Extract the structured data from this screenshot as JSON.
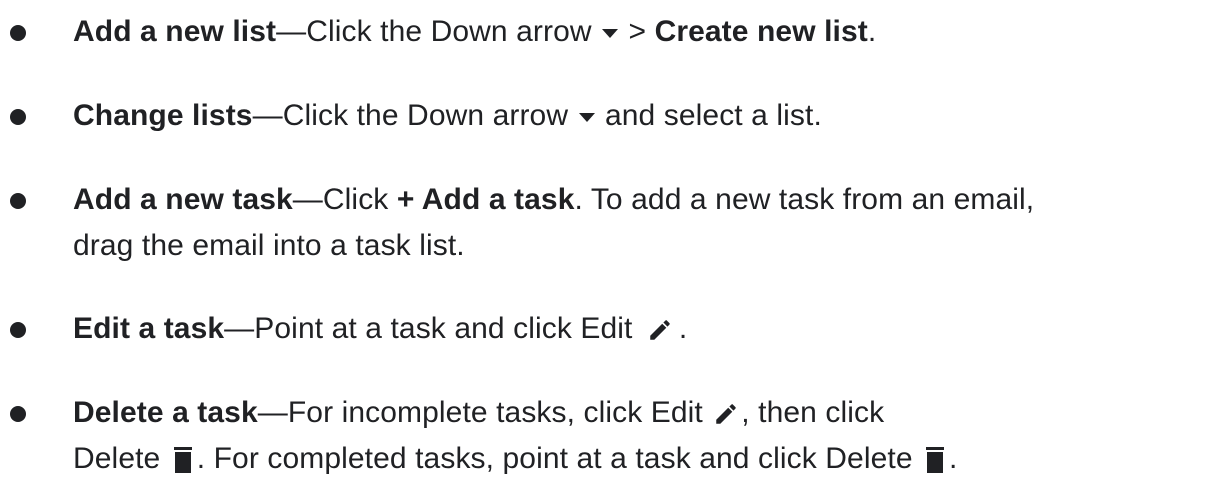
{
  "icons": {
    "down_arrow": "down-arrow-icon",
    "edit": "pencil-icon",
    "delete": "trash-icon"
  },
  "items": [
    {
      "title": "Add a new list",
      "dash": "—",
      "t1": "Click the Down arrow",
      "t2": " > ",
      "b1": "Create new list",
      "t3": "."
    },
    {
      "title": "Change lists",
      "dash": "—",
      "t1": "Click the Down arrow",
      "t2": " and select a list."
    },
    {
      "title": "Add a new task",
      "dash": "—",
      "t1": "Click ",
      "b1": "+ Add a task",
      "t2": ". To add a new task from an email,",
      "t3": "drag the email into a task list."
    },
    {
      "title": "Edit a task",
      "dash": "—",
      "t1": "Point at a task and click Edit",
      "t2": "."
    },
    {
      "title": "Delete a task",
      "dash": "—",
      "t1": "For incomplete tasks, click Edit",
      "t2": ", then click",
      "t3": "Delete",
      "t4": ". For completed tasks, point at a task and click Delete",
      "t5": "."
    }
  ]
}
